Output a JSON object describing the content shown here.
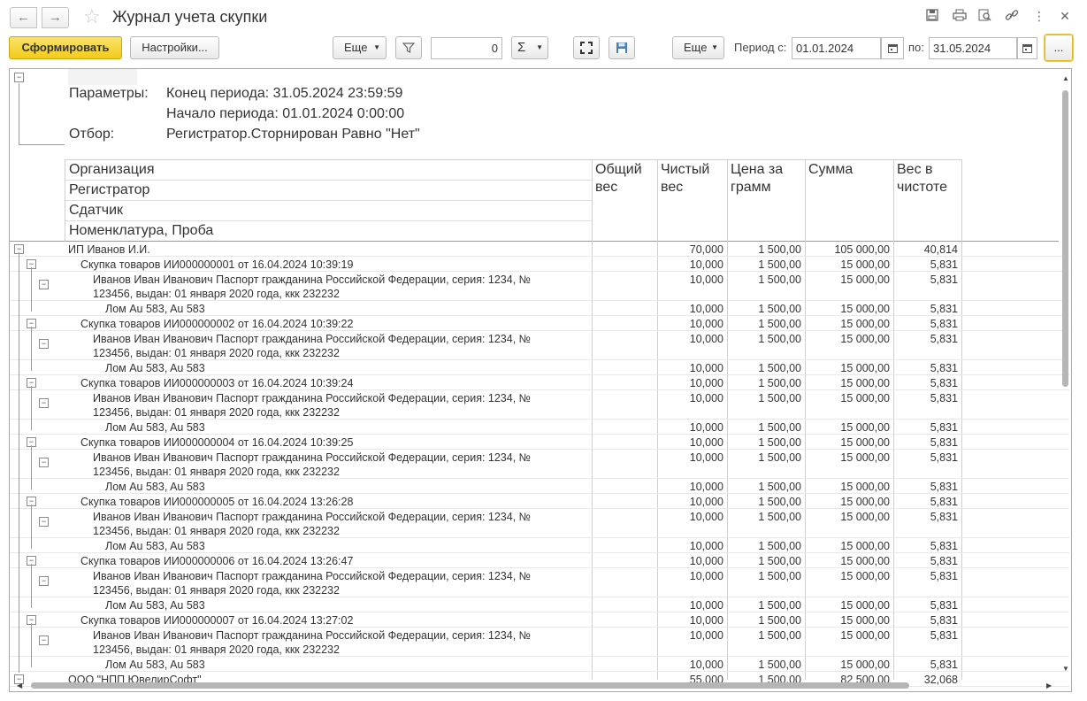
{
  "window": {
    "title": "Журнал учета скупки"
  },
  "toolbar": {
    "generate_label": "Сформировать",
    "settings_label": "Настройки...",
    "more_label": "Еще",
    "counter_value": "0",
    "sum_label": "Σ",
    "more2_label": "Еще",
    "period_from_label": "Период с:",
    "period_from_value": "01.01.2024",
    "period_to_label": "по:",
    "period_to_value": "31.05.2024",
    "ellipsis_label": "..."
  },
  "params": {
    "params_label": "Параметры:",
    "end_period": "Конец периода: 31.05.2024 23:59:59",
    "start_period": "Начало периода: 01.01.2024 0:00:00",
    "filter_label": "Отбор:",
    "filter_value": "Регистратор.Сторнирован Равно \"Нет\""
  },
  "columns": {
    "group_levels": [
      "Организация",
      "Регистратор",
      "Сдатчик",
      "Номенклатура, Проба"
    ],
    "total_weight": "Общий вес",
    "net_weight": "Чистый вес",
    "price_per_gram": "Цена за грамм",
    "sum": "Сумма",
    "pure_weight": "Вес в чистоте"
  },
  "rows": [
    {
      "level": 0,
      "name": "ИП Иванов И.И.",
      "net": "70,000",
      "price": "1 500,00",
      "sum": "105 000,00",
      "pure": "40,814"
    },
    {
      "level": 1,
      "name": "Скупка товаров ИИ000000001 от 16.04.2024 10:39:19",
      "net": "10,000",
      "price": "1 500,00",
      "sum": "15 000,00",
      "pure": "5,831"
    },
    {
      "level": 2,
      "name": "Иванов Иван Иванович Паспорт гражданина Российской Федерации, серия: 1234, №",
      "name2": "123456, выдан: 01 января 2020 года, ккк 232232",
      "net": "10,000",
      "price": "1 500,00",
      "sum": "15 000,00",
      "pure": "5,831"
    },
    {
      "level": 3,
      "name": "Лом Au 583, Au 583",
      "net": "10,000",
      "price": "1 500,00",
      "sum": "15 000,00",
      "pure": "5,831"
    },
    {
      "level": 1,
      "name": "Скупка товаров ИИ000000002 от 16.04.2024 10:39:22",
      "net": "10,000",
      "price": "1 500,00",
      "sum": "15 000,00",
      "pure": "5,831"
    },
    {
      "level": 2,
      "name": "Иванов Иван Иванович Паспорт гражданина Российской Федерации, серия: 1234, №",
      "name2": "123456, выдан: 01 января 2020 года, ккк 232232",
      "net": "10,000",
      "price": "1 500,00",
      "sum": "15 000,00",
      "pure": "5,831"
    },
    {
      "level": 3,
      "name": "Лом Au 583, Au 583",
      "net": "10,000",
      "price": "1 500,00",
      "sum": "15 000,00",
      "pure": "5,831"
    },
    {
      "level": 1,
      "name": "Скупка товаров ИИ000000003 от 16.04.2024 10:39:24",
      "net": "10,000",
      "price": "1 500,00",
      "sum": "15 000,00",
      "pure": "5,831"
    },
    {
      "level": 2,
      "name": "Иванов Иван Иванович Паспорт гражданина Российской Федерации, серия: 1234, №",
      "name2": "123456, выдан: 01 января 2020 года, ккк 232232",
      "net": "10,000",
      "price": "1 500,00",
      "sum": "15 000,00",
      "pure": "5,831"
    },
    {
      "level": 3,
      "name": "Лом Au 583, Au 583",
      "net": "10,000",
      "price": "1 500,00",
      "sum": "15 000,00",
      "pure": "5,831"
    },
    {
      "level": 1,
      "name": "Скупка товаров ИИ000000004 от 16.04.2024 10:39:25",
      "net": "10,000",
      "price": "1 500,00",
      "sum": "15 000,00",
      "pure": "5,831"
    },
    {
      "level": 2,
      "name": "Иванов Иван Иванович Паспорт гражданина Российской Федерации, серия: 1234, №",
      "name2": "123456, выдан: 01 января 2020 года, ккк 232232",
      "net": "10,000",
      "price": "1 500,00",
      "sum": "15 000,00",
      "pure": "5,831"
    },
    {
      "level": 3,
      "name": "Лом Au 583, Au 583",
      "net": "10,000",
      "price": "1 500,00",
      "sum": "15 000,00",
      "pure": "5,831"
    },
    {
      "level": 1,
      "name": "Скупка товаров ИИ000000005 от 16.04.2024 13:26:28",
      "net": "10,000",
      "price": "1 500,00",
      "sum": "15 000,00",
      "pure": "5,831"
    },
    {
      "level": 2,
      "name": "Иванов Иван Иванович Паспорт гражданина Российской Федерации, серия: 1234, №",
      "name2": "123456, выдан: 01 января 2020 года, ккк 232232",
      "net": "10,000",
      "price": "1 500,00",
      "sum": "15 000,00",
      "pure": "5,831"
    },
    {
      "level": 3,
      "name": "Лом Au 583, Au 583",
      "net": "10,000",
      "price": "1 500,00",
      "sum": "15 000,00",
      "pure": "5,831"
    },
    {
      "level": 1,
      "name": "Скупка товаров ИИ000000006 от 16.04.2024 13:26:47",
      "net": "10,000",
      "price": "1 500,00",
      "sum": "15 000,00",
      "pure": "5,831"
    },
    {
      "level": 2,
      "name": "Иванов Иван Иванович Паспорт гражданина Российской Федерации, серия: 1234, №",
      "name2": "123456, выдан: 01 января 2020 года, ккк 232232",
      "net": "10,000",
      "price": "1 500,00",
      "sum": "15 000,00",
      "pure": "5,831"
    },
    {
      "level": 3,
      "name": "Лом Au 583, Au 583",
      "net": "10,000",
      "price": "1 500,00",
      "sum": "15 000,00",
      "pure": "5,831"
    },
    {
      "level": 1,
      "name": "Скупка товаров ИИ000000007 от 16.04.2024 13:27:02",
      "net": "10,000",
      "price": "1 500,00",
      "sum": "15 000,00",
      "pure": "5,831"
    },
    {
      "level": 2,
      "name": "Иванов Иван Иванович Паспорт гражданина Российской Федерации, серия: 1234, №",
      "name2": "123456, выдан: 01 января 2020 года, ккк 232232",
      "net": "10,000",
      "price": "1 500,00",
      "sum": "15 000,00",
      "pure": "5,831"
    },
    {
      "level": 3,
      "name": "Лом Au 583, Au 583",
      "net": "10,000",
      "price": "1 500,00",
      "sum": "15 000,00",
      "pure": "5,831"
    },
    {
      "level": 0,
      "name": "ООО \"НПП ЮвелирСофт\"",
      "net": "55,000",
      "price": "1 500,00",
      "sum": "82 500,00",
      "pure": "32,068"
    }
  ]
}
